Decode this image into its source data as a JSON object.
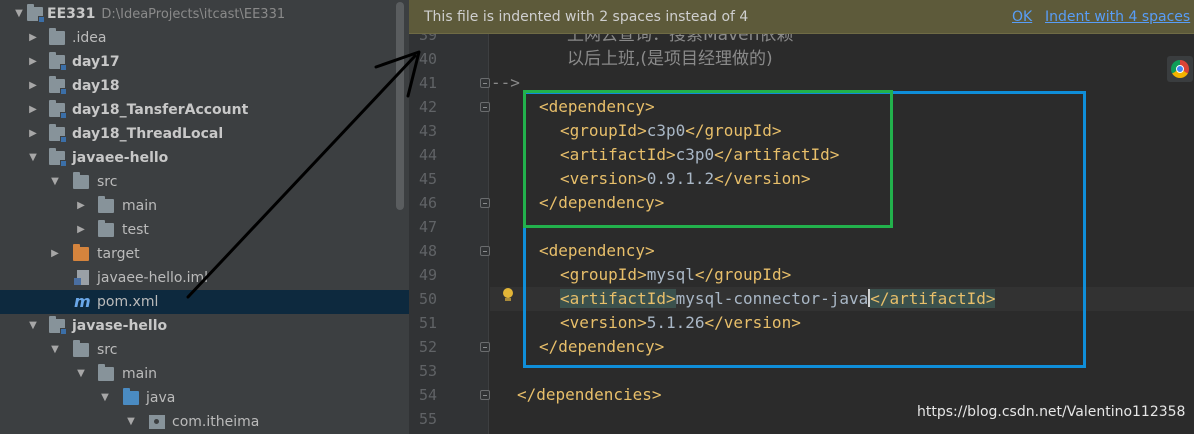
{
  "project_tree": {
    "rows": [
      {
        "label": "EE331",
        "path": "D:\\IdeaProjects\\itcast\\EE331"
      },
      {
        "label": ".idea"
      },
      {
        "label": "day17"
      },
      {
        "label": "day18"
      },
      {
        "label": "day18_TansferAccount"
      },
      {
        "label": "day18_ThreadLocal"
      },
      {
        "label": "javaee-hello"
      },
      {
        "label": "src"
      },
      {
        "label": "main"
      },
      {
        "label": "test"
      },
      {
        "label": "target"
      },
      {
        "label": "javaee-hello.iml"
      },
      {
        "label": "pom.xml"
      },
      {
        "label": "javase-hello"
      },
      {
        "label": "src"
      },
      {
        "label": "main"
      },
      {
        "label": "java"
      },
      {
        "label": "com.itheima"
      }
    ]
  },
  "notification": {
    "text": "This file is indented with 2 spaces instead of 4",
    "ok": "OK",
    "action": "Indent with 4 spaces"
  },
  "editor": {
    "line_numbers": [
      "39",
      "40",
      "41",
      "42",
      "43",
      "44",
      "45",
      "46",
      "47",
      "48",
      "49",
      "50",
      "51",
      "52",
      "53",
      "54",
      "55"
    ],
    "comment_line_39": "上网去查询：搜索Maven依赖",
    "comment_line_40": "以后上班,(是项目经理做的)",
    "comment_close": "-->",
    "tags": {
      "dependency_open": "<dependency>",
      "dependency_close": "</dependency>",
      "groupId_open": "<groupId>",
      "groupId_close": "</groupId>",
      "artifactId_open": "<artifactId>",
      "artifactId_close": "</artifactId>",
      "version_open": "<version>",
      "version_close": "</version>",
      "dependencies_close": "</dependencies>"
    },
    "dep1": {
      "groupId": "c3p0",
      "artifactId": "c3p0",
      "version": "0.9.1.2"
    },
    "dep2": {
      "groupId": "mysql",
      "artifactId": "mysql-connector-java",
      "version": "5.1.26"
    }
  },
  "watermark": "https://blog.csdn.net/Valentino112358",
  "colors": {
    "annotation_green": "#22b14c",
    "annotation_blue": "#0f8ed9",
    "tag_color": "#e8bf6a",
    "link_color": "#589df6"
  }
}
